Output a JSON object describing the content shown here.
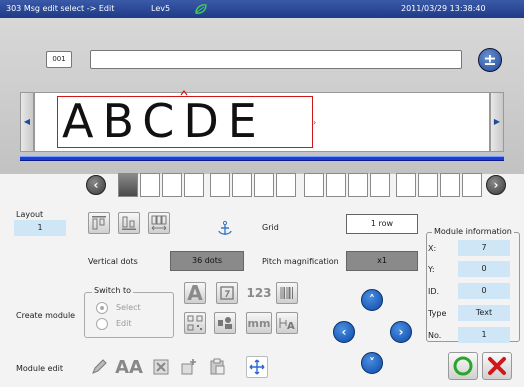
{
  "titlebar": {
    "title": "303 Msg edit select -> Edit",
    "level": "Lev5",
    "datetime": "2011/03/29 13:38:40"
  },
  "editor": {
    "message_number": "001",
    "message_text": "",
    "preview_text": "ABCDE"
  },
  "layout": {
    "label": "Layout",
    "value": "1"
  },
  "grid": {
    "label": "Grid",
    "value": "1 row"
  },
  "vertical_dots": {
    "label": "Vertical dots",
    "value": "36 dots"
  },
  "pitch": {
    "label": "Pitch magnification",
    "value": "x1"
  },
  "create_module": {
    "label": "Create module",
    "switch_title": "Switch to",
    "options": [
      "Select",
      "Edit"
    ]
  },
  "module_edit": {
    "label": "Module edit"
  },
  "module_information": {
    "title": "Module information",
    "rows": [
      {
        "label": "X:",
        "value": "7"
      },
      {
        "label": "Y:",
        "value": "0"
      },
      {
        "label": "ID.",
        "value": "0"
      },
      {
        "label": "Type",
        "value": "Text"
      },
      {
        "label": "No.",
        "value": "1"
      }
    ]
  },
  "icons": {
    "text_glyph": "A",
    "counter_glyph": "123",
    "unit_glyph": "mm",
    "char_sizes": "AA"
  },
  "colors": {
    "titlebar": "#1f3a86",
    "accent_blue": "#0c48a8",
    "selection_red": "#d01818",
    "ok_green": "#2aa52a",
    "cancel_red": "#d01818"
  }
}
